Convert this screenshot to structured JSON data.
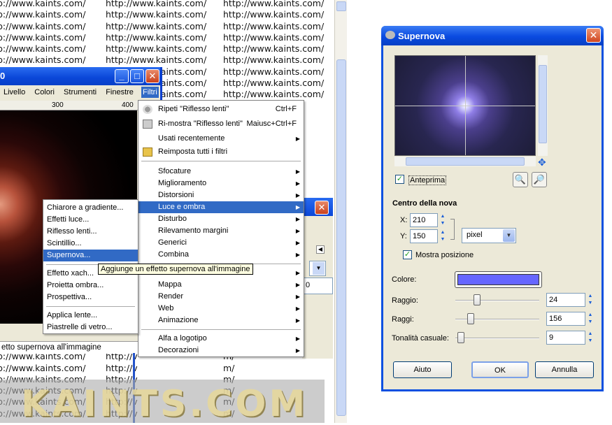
{
  "background": {
    "url_line": "http://www.kaints.com/",
    "url_line_short_left": "p://www.kaints.com/",
    "url_fragment": "m/",
    "url_fragment2": "http://v",
    "watermark": "KAINTS.COM"
  },
  "image_window": {
    "title": "0",
    "menu": [
      "Livello",
      "Colori",
      "Strumenti",
      "Finestre",
      "Filtri"
    ],
    "ruler_marks": [
      "300",
      "400"
    ],
    "status": "etto supernova all'immagine"
  },
  "filters_menu": {
    "items": [
      {
        "label": "Ripeti \"Riflesso lenti\"",
        "accel": "Ctrl+F",
        "icon": "repeat-icon"
      },
      {
        "label": "Ri-mostra \"Riflesso lenti\"",
        "accel": "Maiusc+Ctrl+F",
        "icon": "reshow-icon"
      },
      {
        "label": "Usati recentemente",
        "submenu": true
      },
      {
        "label": "Reimposta tutti i filtri",
        "icon": "reset-icon"
      }
    ],
    "groups": [
      "Sfocature",
      "Miglioramento",
      "Distorsioni",
      "Luce e ombra",
      "Disturbo",
      "Rilevamento margini",
      "Generici",
      "Combina"
    ],
    "groups2": [
      "",
      "Mappa",
      "Render",
      "Web",
      "Animazione"
    ],
    "groups3": [
      "Alfa a logotipo",
      "Decorazioni"
    ]
  },
  "light_submenu": {
    "items": [
      "Chiarore a gradiente...",
      "Effetti luce...",
      "Riflesso lenti...",
      "Scintillio...",
      "Supernova..."
    ],
    "items2": [
      "Effetto xach...",
      "Proietta ombra...",
      "Prospettiva..."
    ],
    "items3": [
      "Applica lente...",
      "Piastrelle di vetro..."
    ]
  },
  "tooltip": "Aggiunge un effetto supernova all'immagine",
  "dialog": {
    "title": "Supernova",
    "preview_label": "Anteprima",
    "preview_checked": true,
    "center_heading": "Centro della nova",
    "x_label": "X:",
    "x_value": "210",
    "y_label": "Y:",
    "y_value": "150",
    "unit": "pixel",
    "show_position_label": "Mostra posizione",
    "show_position_checked": true,
    "color_label": "Colore:",
    "color": "#6666ff",
    "radius_label": "Raggio:",
    "radius_value": "24",
    "spokes_label": "Raggi:",
    "spokes_value": "156",
    "hue_label": "Tonalità casuale:",
    "hue_value": "9",
    "help_button": "Aiuto",
    "ok_button": "OK",
    "cancel_button": "Annulla"
  }
}
